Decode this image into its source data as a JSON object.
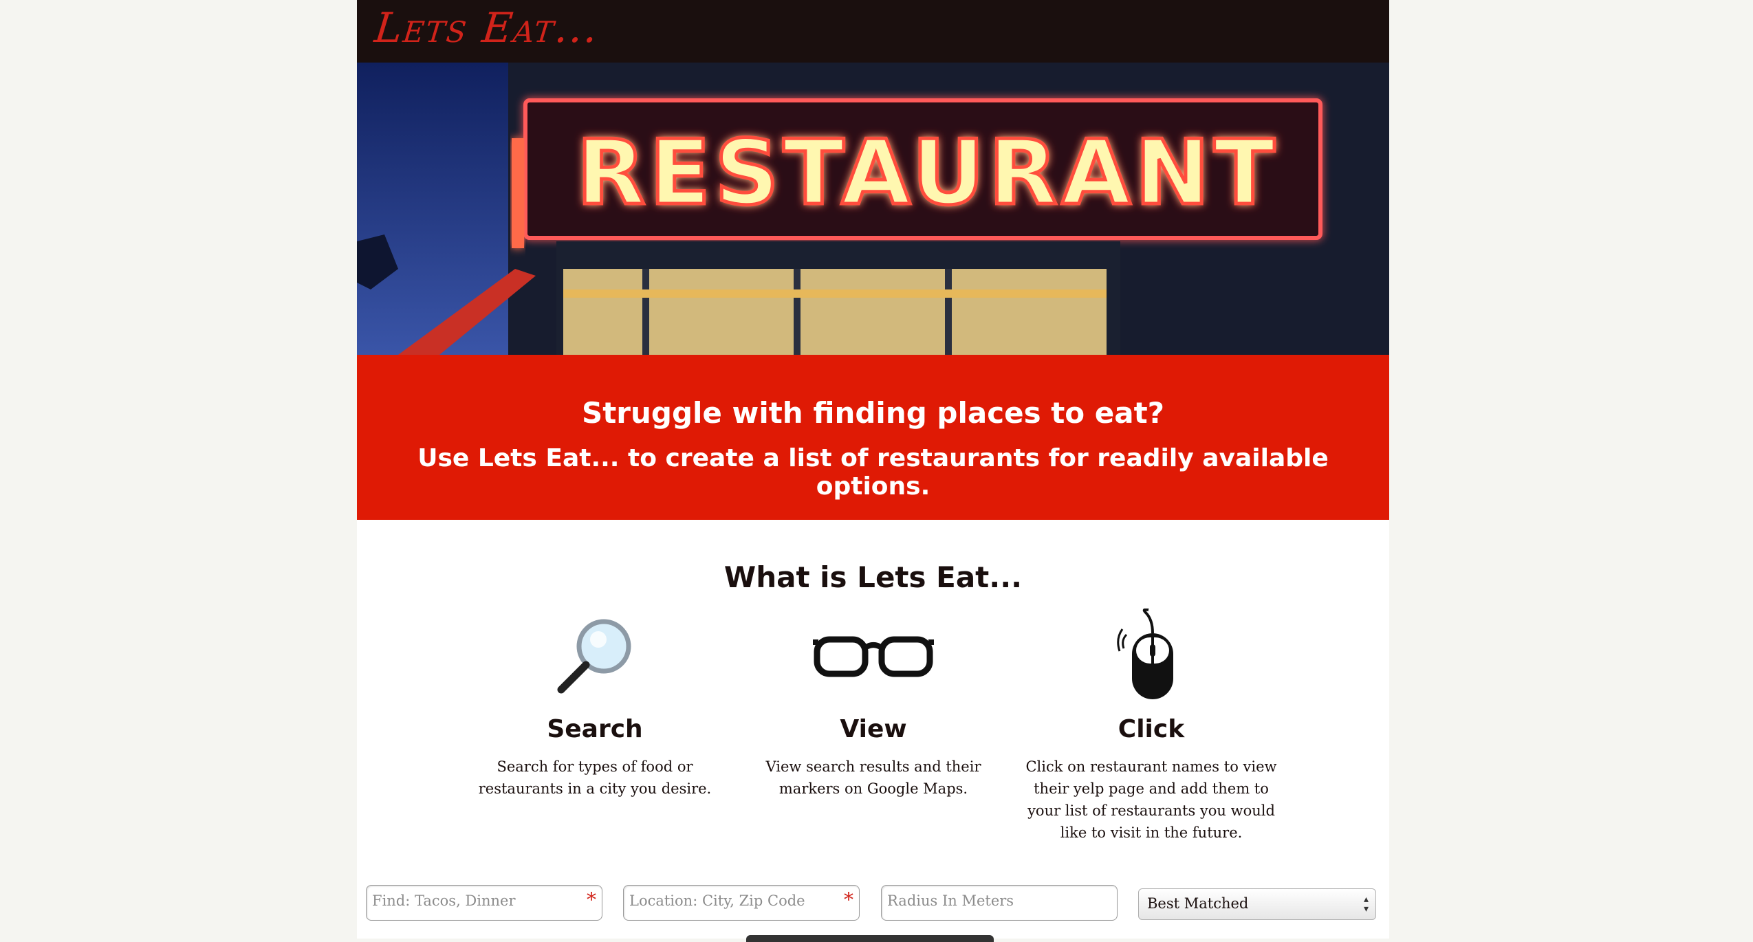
{
  "header": {
    "logo": "Lets Eat..."
  },
  "hero": {
    "sign_text": "RESTAURANT"
  },
  "banner": {
    "line1": "Struggle with finding places to eat?",
    "line2": "Use Lets Eat... to create a list of restaurants for readily available options."
  },
  "about": {
    "title": "What is Lets Eat...",
    "features": [
      {
        "name": "Search",
        "icon": "magnifying-glass-icon",
        "description": "Search for types of food or restaurants in a city you desire."
      },
      {
        "name": "View",
        "icon": "glasses-icon",
        "description": "View search results and their markers on Google Maps."
      },
      {
        "name": "Click",
        "icon": "mouse-icon",
        "description": "Click on restaurant names to view their yelp page and add them to your list of restaurants you would like to visit in the future."
      }
    ]
  },
  "search_form": {
    "find_placeholder": "Find: Tacos, Dinner",
    "location_placeholder": "Location: City, Zip Code",
    "radius_placeholder": "Radius In Meters",
    "required_marker": "*",
    "sort_selected": "Best Matched"
  },
  "colors": {
    "header_bg": "#1a0f0e",
    "accent_red": "#df1a05",
    "logo_red": "#d1231a"
  }
}
